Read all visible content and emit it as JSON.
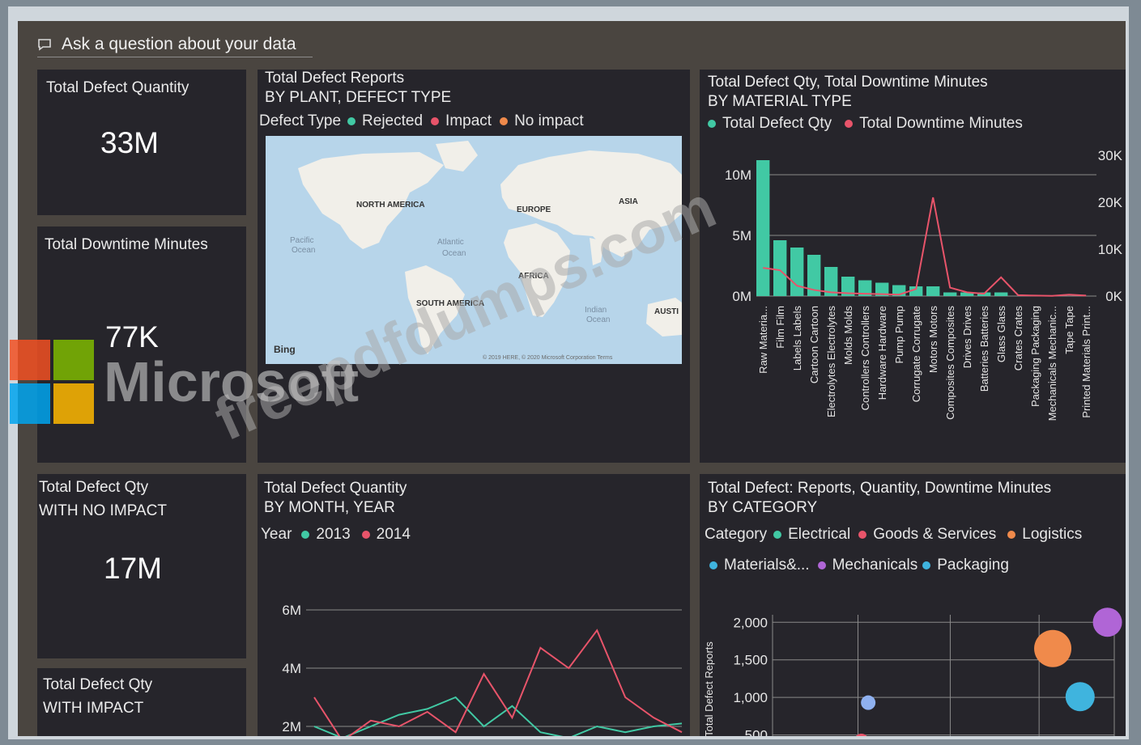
{
  "qa": {
    "label": "Ask a question about your data",
    "icon": "chat-icon"
  },
  "kpis": [
    {
      "title": "Total Defect Quantity",
      "value": "33M"
    },
    {
      "title": "Total Downtime Minutes",
      "value": "77K"
    },
    {
      "title1": "Total Defect Qty",
      "title2": "WITH NO IMPACT",
      "value": "17M"
    },
    {
      "title1": "Total Defect Qty",
      "title2": "WITH IMPACT"
    }
  ],
  "map": {
    "title1": "Total Defect Reports",
    "title2": "BY PLANT, DEFECT TYPE",
    "legend_title": "Defect Type",
    "legend": [
      {
        "label": "Rejected",
        "color": "#41c9a4"
      },
      {
        "label": "Impact",
        "color": "#e8546a"
      },
      {
        "label": "No impact",
        "color": "#f08a4b"
      }
    ],
    "labels": [
      "NORTH AMERICA",
      "EUROPE",
      "ASIA",
      "AFRICA",
      "SOUTH AMERICA",
      "AUSTI",
      "Pacific",
      "Ocean",
      "Atlantic",
      "Ocean",
      "Indian",
      "Ocean"
    ],
    "bing": "Bing",
    "copyright": "© 2019 HERE, © 2020 Microsoft Corporation Terms"
  },
  "combo": {
    "title1": "Total Defect Qty, Total Downtime Minutes",
    "title2": "BY MATERIAL TYPE",
    "legend": [
      {
        "label": "Total Defect Qty",
        "color": "#41c9a4"
      },
      {
        "label": "Total Downtime Minutes",
        "color": "#e8546a"
      }
    ]
  },
  "month": {
    "title1": "Total Defect Quantity",
    "title2": "BY MONTH, YEAR",
    "legend_title": "Year",
    "legend": [
      {
        "label": "2013",
        "color": "#41c9a4"
      },
      {
        "label": "2014",
        "color": "#e8546a"
      }
    ]
  },
  "scatter": {
    "title1": "Total Defect: Reports, Quantity, Downtime Minutes",
    "title2": "BY CATEGORY",
    "legend_title": "Category",
    "legend_row1": [
      {
        "label": "Electrical",
        "color": "#41c9a4"
      },
      {
        "label": "Goods & Services",
        "color": "#e8546a"
      },
      {
        "label": "Logistics",
        "color": "#f08a4b"
      }
    ],
    "legend_row2": [
      {
        "label": "Materials&...",
        "color": "#3fb4de"
      },
      {
        "label": "Mechanicals",
        "color": "#b065d6"
      },
      {
        "label": "Packaging",
        "color": "#3fb4de"
      }
    ]
  },
  "watermark": {
    "site": "freepdfdumps.com",
    "brand": "Microsoft"
  },
  "chart_data": [
    {
      "type": "bar",
      "categories": [
        "Raw Materia...",
        "Film Film",
        "Labels Labels",
        "Cartoon Cartoon",
        "Electrolytes Electrolytes",
        "Molds Molds",
        "Controllers Controllers",
        "Hardware Hardware",
        "Pump Pump",
        "Corrugate Corrugate",
        "Motors Motors",
        "Composites Composites",
        "Drives Drives",
        "Batteries Batteries",
        "Glass Glass",
        "Crates Crates",
        "Packaging Packaging",
        "Mechanicals Mechanic...",
        "Tape Tape",
        "Printed Materials Print..."
      ],
      "series": [
        {
          "name": "Total Defect Qty",
          "values": [
            11.2,
            4.6,
            4.0,
            3.4,
            2.4,
            1.6,
            1.3,
            1.1,
            0.9,
            0.8,
            0.8,
            0.3,
            0.3,
            0.3,
            0.3,
            0.0,
            0.0,
            0.0,
            0.0,
            0.0
          ]
        },
        {
          "name": "Total Downtime Minutes",
          "values": [
            6000,
            5500,
            2200,
            1300,
            800,
            600,
            500,
            400,
            300,
            1500,
            21000,
            1800,
            800,
            500,
            4000,
            200,
            100,
            50,
            300,
            100
          ]
        }
      ],
      "y_ticks": [
        "0M",
        "5M",
        "10M"
      ],
      "y2_ticks": [
        "0K",
        "10K",
        "20K",
        "30K"
      ],
      "ylim": [
        0,
        12
      ],
      "y2lim": [
        0,
        31000
      ]
    },
    {
      "type": "line",
      "y_ticks": [
        "2M",
        "4M",
        "6M"
      ],
      "ylim": [
        1.5,
        6.5
      ],
      "series": [
        {
          "name": "2013",
          "values": [
            2.0,
            1.6,
            2.0,
            2.4,
            2.6,
            3.0,
            2.0,
            2.7,
            1.8,
            1.6,
            2.0,
            1.8,
            2.0,
            2.1
          ]
        },
        {
          "name": "2014",
          "values": [
            3.0,
            1.5,
            2.2,
            2.0,
            2.5,
            1.8,
            3.8,
            2.3,
            4.7,
            4.0,
            5.3,
            3.0,
            2.3,
            1.8
          ]
        }
      ]
    },
    {
      "type": "scatter",
      "ylabel": "Total Defect Reports",
      "y_ticks": [
        "500",
        "1,000",
        "1,500",
        "2,000"
      ],
      "ylim": [
        420,
        2100
      ],
      "points": [
        {
          "category": "Materials&...",
          "x": 0.28,
          "y": 930,
          "size": 9,
          "color": "#8fb1f0"
        },
        {
          "category": "Logistics",
          "x": 0.82,
          "y": 1650,
          "size": 23,
          "color": "#f08a4b"
        },
        {
          "category": "Packaging",
          "x": 0.9,
          "y": 1010,
          "size": 18,
          "color": "#3fb4de"
        },
        {
          "category": "Mechanicals",
          "x": 0.98,
          "y": 2000,
          "size": 18,
          "color": "#b065d6"
        },
        {
          "category": "Goods & Services",
          "x": 0.26,
          "y": 420,
          "size": 9,
          "color": "#e8546a"
        }
      ]
    }
  ]
}
